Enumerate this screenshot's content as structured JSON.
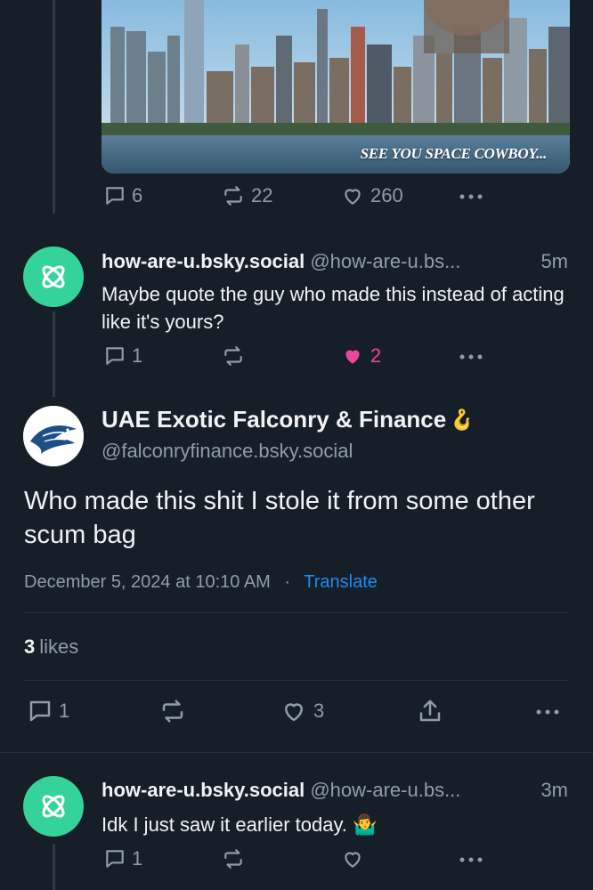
{
  "embed": {
    "caption": "SEE YOU SPACE COWBOY..."
  },
  "top_actions": {
    "replies": "6",
    "reposts": "22",
    "likes": "260"
  },
  "reply1": {
    "name": "how-are-u.bsky.social",
    "handle": "@how-are-u.bs...",
    "time": "5m",
    "text": "Maybe quote the guy who made this instead of acting like it's yours?",
    "replies": "1",
    "likes": "2"
  },
  "main": {
    "name": "UAE Exotic Falconry & Finance",
    "name_emoji": "🪝",
    "handle": "@falconryfinance.bsky.social",
    "text": "Who made this shit I stole it from some other scum bag",
    "timestamp": "December 5, 2024 at 10:10 AM",
    "dot": "·",
    "translate": "Translate",
    "likes_count": "3",
    "likes_label": "likes",
    "replies": "1",
    "like_count": "3"
  },
  "reply2": {
    "name": "how-are-u.bsky.social",
    "handle": "@how-are-u.bs...",
    "time": "3m",
    "text": "Idk I just saw it earlier today. 🤷‍♂️",
    "replies": "1"
  },
  "colors": {
    "background": "#161e27",
    "text_muted": "#8f9dab",
    "accent_blue": "#1d8cf3",
    "like_pink": "#ec4899",
    "avatar_green": "#34d399"
  }
}
